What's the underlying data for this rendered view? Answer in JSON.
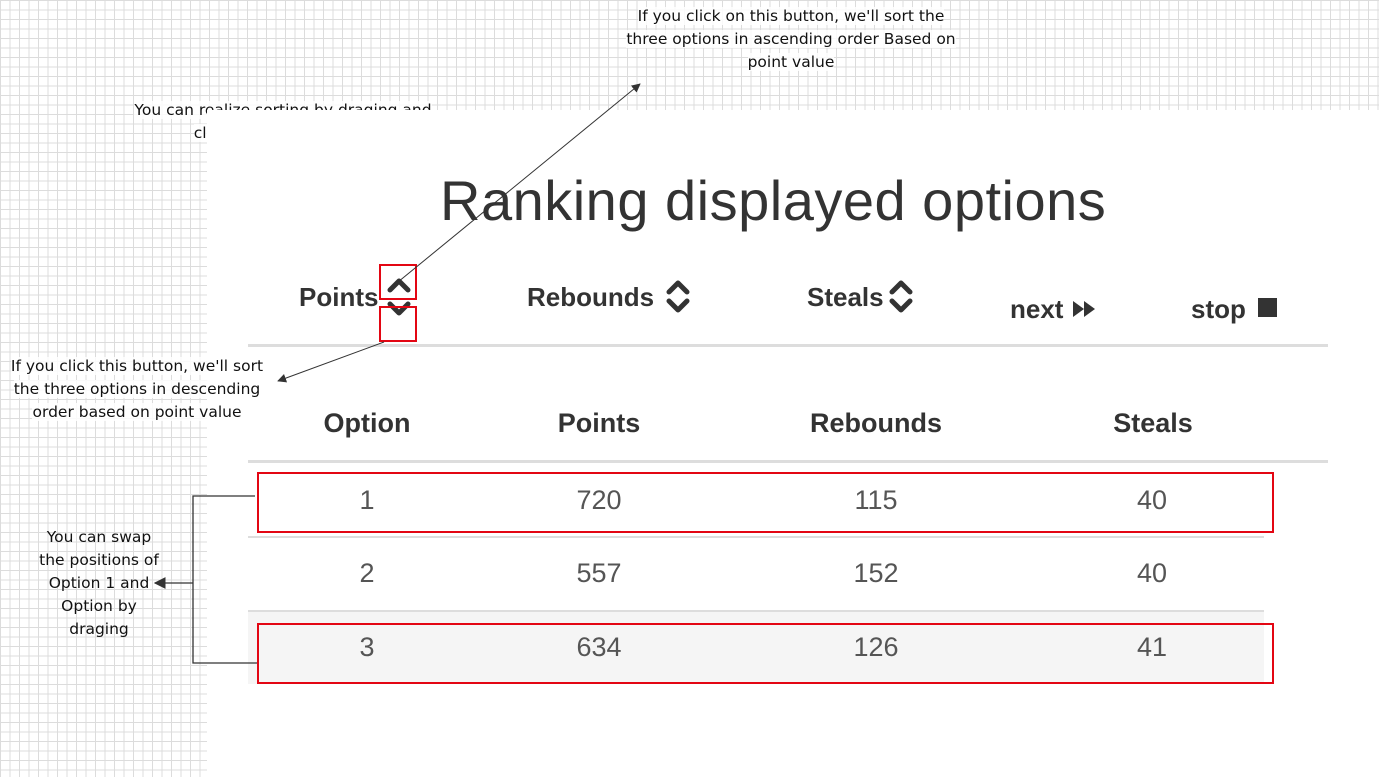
{
  "annotations": {
    "top_right": "If you click on this button, we'll sort the three options in ascending order Based on point value",
    "top_left": "You can realize sorting by draging and clicking sorting button.",
    "middle_left": "If you click this button, we'll sort the three options in descending order based on point value",
    "bottom_left": "You can swap the positions of Option 1 and Option by draging"
  },
  "app": {
    "title": "Ranking displayed options",
    "controls": {
      "points_label": "Points",
      "rebounds_label": "Rebounds",
      "steals_label": "Steals",
      "next_label": "next",
      "stop_label": "stop"
    },
    "table": {
      "headers": [
        "Option",
        "Points",
        "Rebounds",
        "Steals"
      ],
      "rows": [
        [
          "1",
          "720",
          "115",
          "40"
        ],
        [
          "2",
          "557",
          "152",
          "40"
        ],
        [
          "3",
          "634",
          "126",
          "41"
        ]
      ]
    },
    "colors": {
      "highlight": "#e30613",
      "text": "#333333"
    },
    "icons": [
      "chevron-up-icon",
      "chevron-down-icon",
      "fast-forward-icon",
      "stop-square-icon"
    ]
  }
}
